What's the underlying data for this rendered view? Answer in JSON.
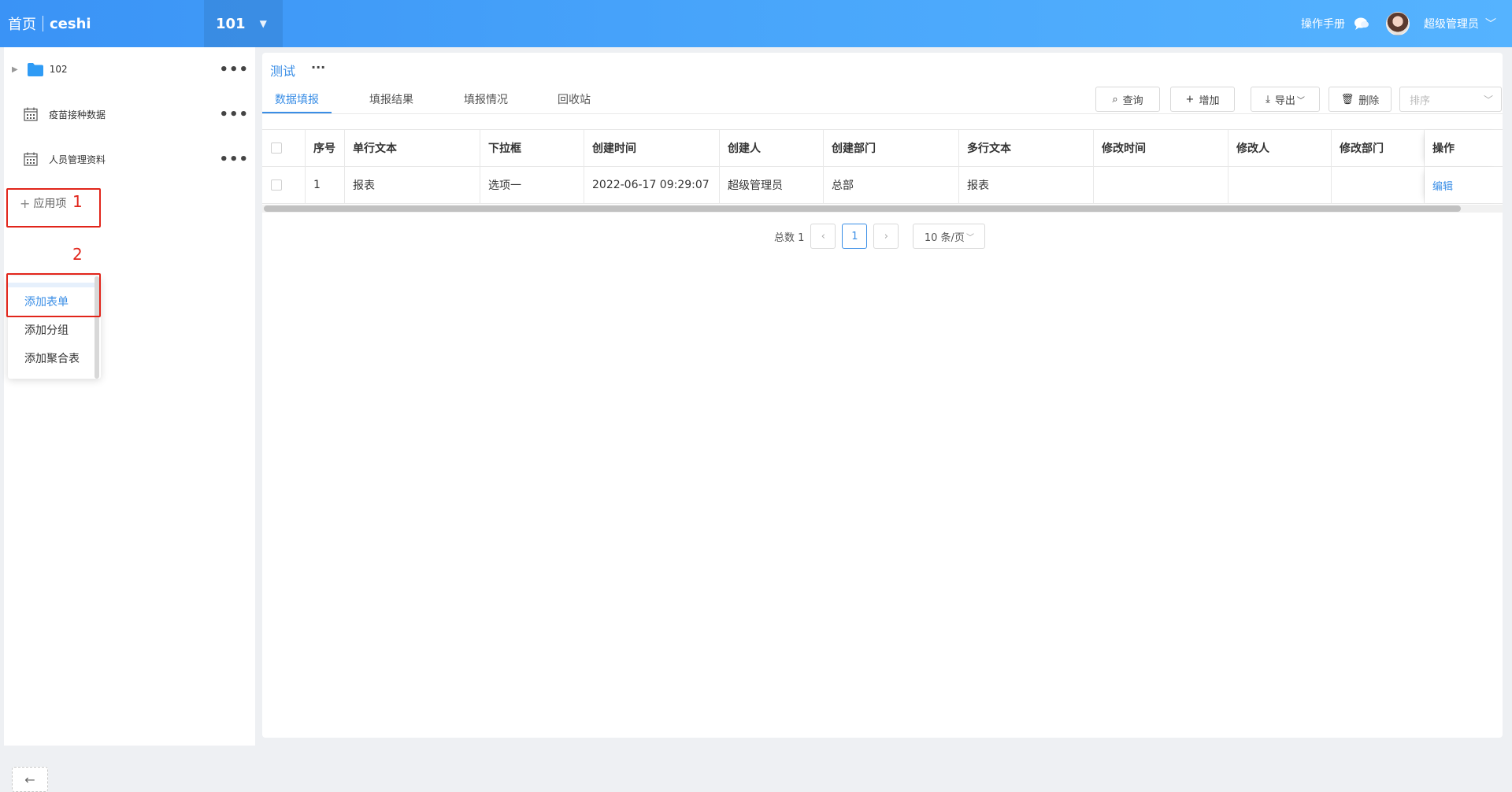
{
  "header": {
    "home": "首页",
    "app_name": "ceshi",
    "app_switch": "101",
    "manual": "操作手册",
    "user": "超级管理员"
  },
  "sidebar": {
    "items": [
      {
        "label": "102",
        "icon": "folder-icon"
      },
      {
        "label": "疫苗接种数据",
        "icon": "calendar-icon"
      },
      {
        "label": "人员管理资料",
        "icon": "calendar-icon"
      }
    ],
    "add_item": "应用项",
    "menu": [
      "添加表单",
      "添加分组",
      "添加聚合表"
    ],
    "annotations": [
      "1",
      "2"
    ]
  },
  "main": {
    "title": "测试",
    "tabs": [
      "数据填报",
      "填报结果",
      "填报情况",
      "回收站"
    ],
    "toolbar": {
      "query": "查询",
      "add": "增加",
      "export": "导出",
      "delete": "删除",
      "sort_placeholder": "排序"
    },
    "table": {
      "columns": [
        "序号",
        "单行文本",
        "下拉框",
        "创建时间",
        "创建人",
        "创建部门",
        "多行文本",
        "修改时间",
        "修改人",
        "修改部门",
        "操作"
      ],
      "rows": [
        [
          "1",
          "报表",
          "选项一",
          "2022-06-17 09:29:07",
          "超级管理员",
          "总部",
          "报表",
          "",
          "",
          "",
          "编辑"
        ]
      ]
    },
    "pagination": {
      "total": "总数 1",
      "current": "1",
      "page_size": "10 条/页"
    }
  },
  "colors": {
    "primary": "#3a8ee6",
    "header_start": "#3a93f6",
    "header_end": "#55b3ff",
    "annotation": "#e1251b"
  }
}
